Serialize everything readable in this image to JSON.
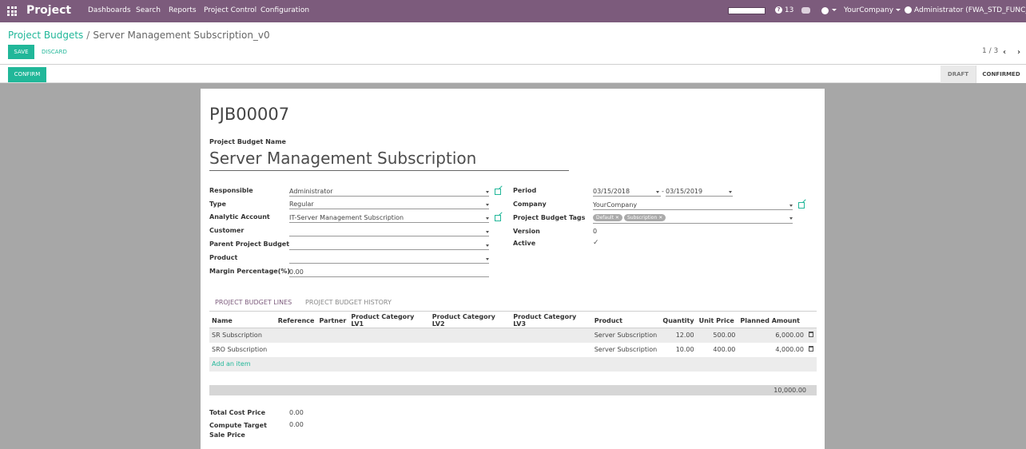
{
  "navbar": {
    "app_name": "Project",
    "menu": [
      "Dashboards",
      "Search",
      "Reports",
      "Project Control",
      "Configuration"
    ],
    "messages_count": "13",
    "company": "YourCompany",
    "user": "Administrator (FWA_STD_FUNC_VT)"
  },
  "breadcrumb": {
    "parent": "Project Budgets",
    "separator": "/",
    "current": "Server Management Subscription_v0"
  },
  "buttons": {
    "save": "SAVE",
    "discard": "DISCARD",
    "confirm": "CONFIRM"
  },
  "pager": {
    "text": "1 / 3"
  },
  "status": {
    "draft": "DRAFT",
    "confirmed": "CONFIRMED"
  },
  "record": {
    "code": "PJB00007",
    "name_label": "Project Budget Name",
    "name": "Server Management Subscription"
  },
  "left_fields": [
    {
      "label": "Responsible",
      "value": "Administrator"
    },
    {
      "label": "Type",
      "value": "Regular"
    },
    {
      "label": "Analytic Account",
      "value": "IT-Server Management Subscription"
    },
    {
      "label": "Customer",
      "value": ""
    },
    {
      "label": "Parent Project Budget",
      "value": ""
    },
    {
      "label": "Product",
      "value": ""
    },
    {
      "label": "Margin Percentage(%)",
      "value": "0.00"
    }
  ],
  "right_fields": {
    "period_label": "Period",
    "period_start": "03/15/2018",
    "period_sep": "-",
    "period_end": "03/15/2019",
    "company_label": "Company",
    "company_value": "YourCompany",
    "tags_label": "Project Budget Tags",
    "tags": [
      "Default",
      "Subscription"
    ],
    "version_label": "Version",
    "version_value": "0",
    "active_label": "Active",
    "active_checked": true
  },
  "tabs": [
    "PROJECT BUDGET LINES",
    "PROJECT BUDGET HISTORY"
  ],
  "table": {
    "columns": [
      "Name",
      "Reference",
      "Partner",
      "Product Category LV1",
      "Product Category LV2",
      "Product Category LV3",
      "Product",
      "Quantity",
      "Unit Price",
      "Planned Amount"
    ],
    "rows": [
      {
        "name": "SR Subscription",
        "product": "Server Subscription",
        "quantity": "12.00",
        "unit_price": "500.00",
        "amount": "6,000.00"
      },
      {
        "name": "SRO Subscription",
        "product": "Server Subscription",
        "quantity": "10.00",
        "unit_price": "400.00",
        "amount": "4,000.00"
      }
    ],
    "add_item": "Add an item",
    "total": "10,000.00"
  },
  "summary": [
    {
      "label": "Total Cost Price",
      "value": "0.00"
    },
    {
      "label": "Compute Target Sale Price",
      "value": "0.00"
    }
  ],
  "colors": {
    "brand": "#7c5b7c",
    "accent": "#21b799"
  }
}
